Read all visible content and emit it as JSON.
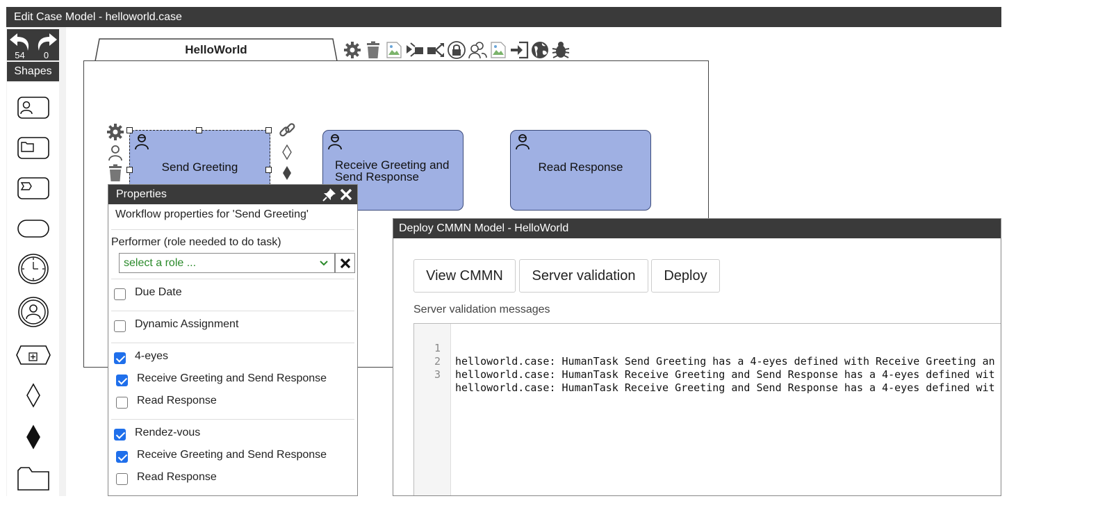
{
  "window": {
    "title": "Edit Case Model - helloworld.case"
  },
  "undo": {
    "count": "54"
  },
  "redo": {
    "count": "0"
  },
  "shapes": {
    "header": "Shapes",
    "items": [
      "human-task-shape",
      "case-file-item-shape",
      "process-task-shape",
      "stage-shape",
      "timer-event-shape",
      "user-event-shape",
      "case-task-shape",
      "entry-criterion-shape",
      "exit-criterion-shape",
      "case-file-shape"
    ]
  },
  "tab": {
    "label": "HelloWorld"
  },
  "tasks": [
    {
      "name": "Send Greeting"
    },
    {
      "name": "Receive Greeting and Send Response"
    },
    {
      "name": "Read Response"
    }
  ],
  "properties": {
    "title": "Properties",
    "subtitle": "Workflow properties for  'Send Greeting'",
    "performer_label": "Performer (role needed to do task)",
    "role_placeholder": "select a role ...",
    "due_date": {
      "label": "Due Date",
      "checked": false
    },
    "dynamic_assignment": {
      "label": "Dynamic Assignment",
      "checked": false
    },
    "four_eyes": {
      "label": "4-eyes",
      "checked": true,
      "items": [
        {
          "label": "Receive Greeting and Send Response",
          "checked": true
        },
        {
          "label": "Read Response",
          "checked": false
        }
      ]
    },
    "rendezvous": {
      "label": "Rendez-vous",
      "checked": true,
      "items": [
        {
          "label": "Receive Greeting and Send Response",
          "checked": true
        },
        {
          "label": "Read Response",
          "checked": false
        }
      ]
    }
  },
  "deploy": {
    "title": "Deploy CMMN Model - HelloWorld",
    "buttons": {
      "view": "View CMMN",
      "validate": "Server validation",
      "deploy": "Deploy"
    },
    "messages_label": "Server validation messages",
    "lines": [
      {
        "n": "1",
        "text": "helloworld.case: HumanTask Send Greeting has a 4-eyes defined with Receive Greeting an"
      },
      {
        "n": "2",
        "text": "helloworld.case: HumanTask Receive Greeting and Send Response has a 4-eyes defined wit"
      },
      {
        "n": "3",
        "text": "helloworld.case: HumanTask Receive Greeting and Send Response has a 4-eyes defined wit"
      }
    ]
  }
}
